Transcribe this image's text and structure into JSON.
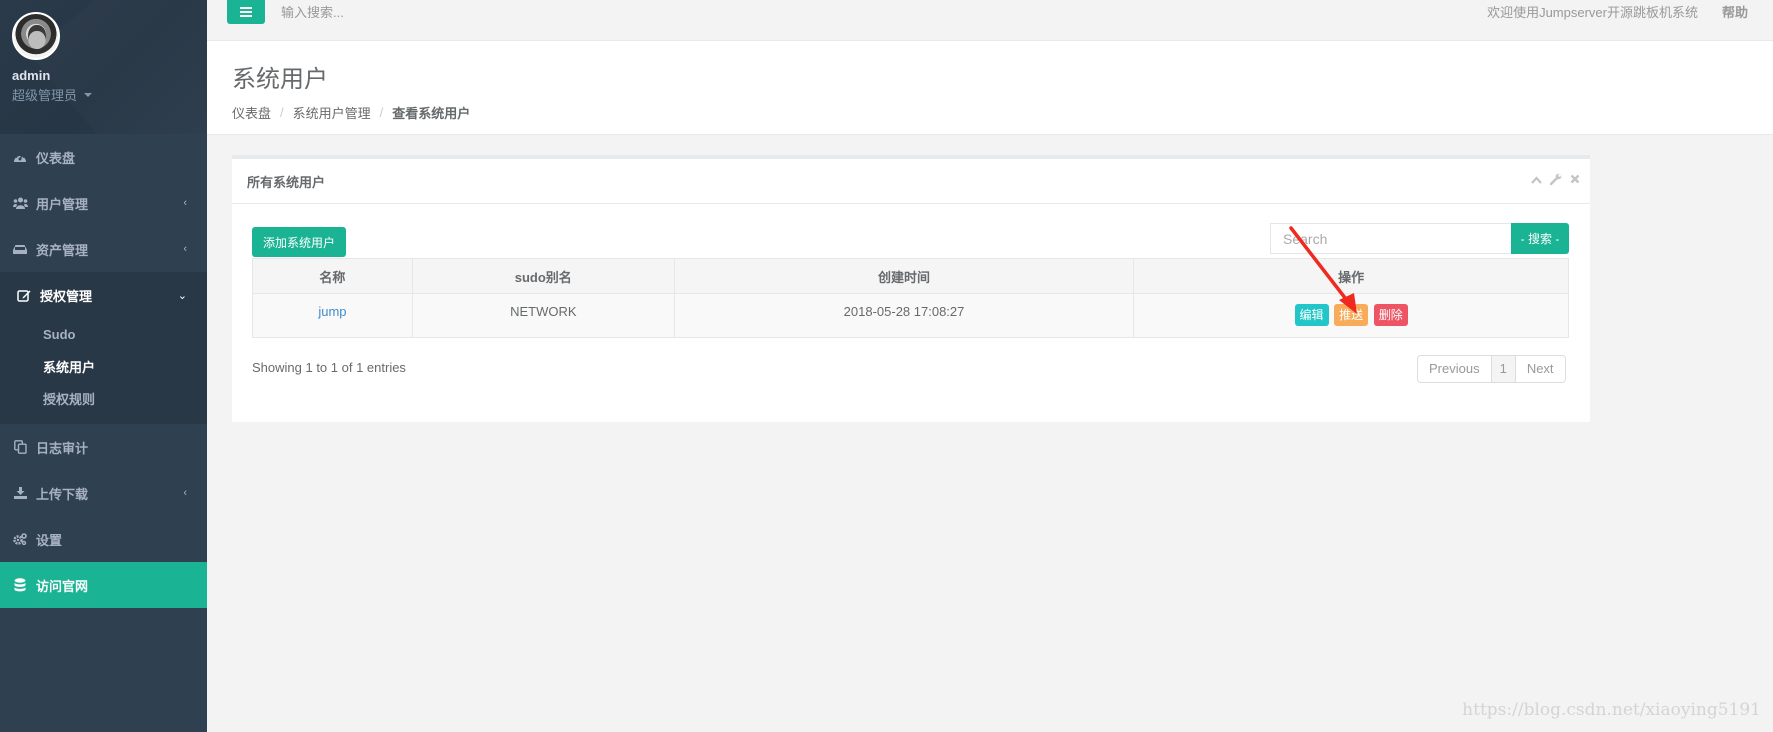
{
  "sidebar": {
    "profile": {
      "name": "admin",
      "role": "超级管理员"
    },
    "items": [
      {
        "label": "仪表盘",
        "icon": "dashboard-icon"
      },
      {
        "label": "用户管理",
        "icon": "users-icon",
        "has_children": true
      },
      {
        "label": "资产管理",
        "icon": "inbox-icon",
        "has_children": true
      },
      {
        "label": "授权管理",
        "icon": "edit-icon",
        "expanded": true,
        "children": [
          {
            "label": "Sudo"
          },
          {
            "label": "系统用户",
            "active": true
          },
          {
            "label": "授权规则"
          }
        ]
      },
      {
        "label": "日志审计",
        "icon": "files-icon"
      },
      {
        "label": "上传下载",
        "icon": "download-icon",
        "has_children": true
      },
      {
        "label": "设置",
        "icon": "cogs-icon"
      },
      {
        "label": "访问官网",
        "icon": "database-icon",
        "highlight": true
      }
    ],
    "arrow_left": "‹",
    "arrow_down": "⌄"
  },
  "topbar": {
    "search_placeholder": "输入搜索...",
    "welcome": "欢迎使用Jumpserver开源跳板机系统",
    "help": "帮助"
  },
  "page": {
    "title": "系统用户",
    "breadcrumb": [
      "仪表盘",
      "系统用户管理",
      "查看系统用户"
    ],
    "breadcrumb_sep": "/"
  },
  "panel": {
    "title": "所有系统用户",
    "tools": {
      "collapse": "^",
      "config": "🔧",
      "close": "✕"
    },
    "add_button": "添加系统用户",
    "search_placeholder": "Search",
    "search_button": "- 搜索 -",
    "table": {
      "columns": [
        "名称",
        "sudo别名",
        "创建时间",
        "操作"
      ],
      "rows": [
        {
          "name": "jump",
          "sudo_alias": "NETWORK",
          "created": "2018-05-28 17:08:27",
          "actions": {
            "edit": "编辑",
            "push": "推送",
            "delete": "删除"
          }
        }
      ]
    },
    "info": "Showing 1 to 1 of 1 entries",
    "pagination": {
      "previous": "Previous",
      "current": "1",
      "next": "Next"
    }
  },
  "colors": {
    "primary": "#1ab394",
    "sidebar": "#2f4050",
    "info": "#23c6c8",
    "warning": "#f8ac59",
    "danger": "#ed5565",
    "annotation_arrow": "#f02a1e"
  },
  "watermark": "https://blog.csdn.net/xiaoying5191"
}
